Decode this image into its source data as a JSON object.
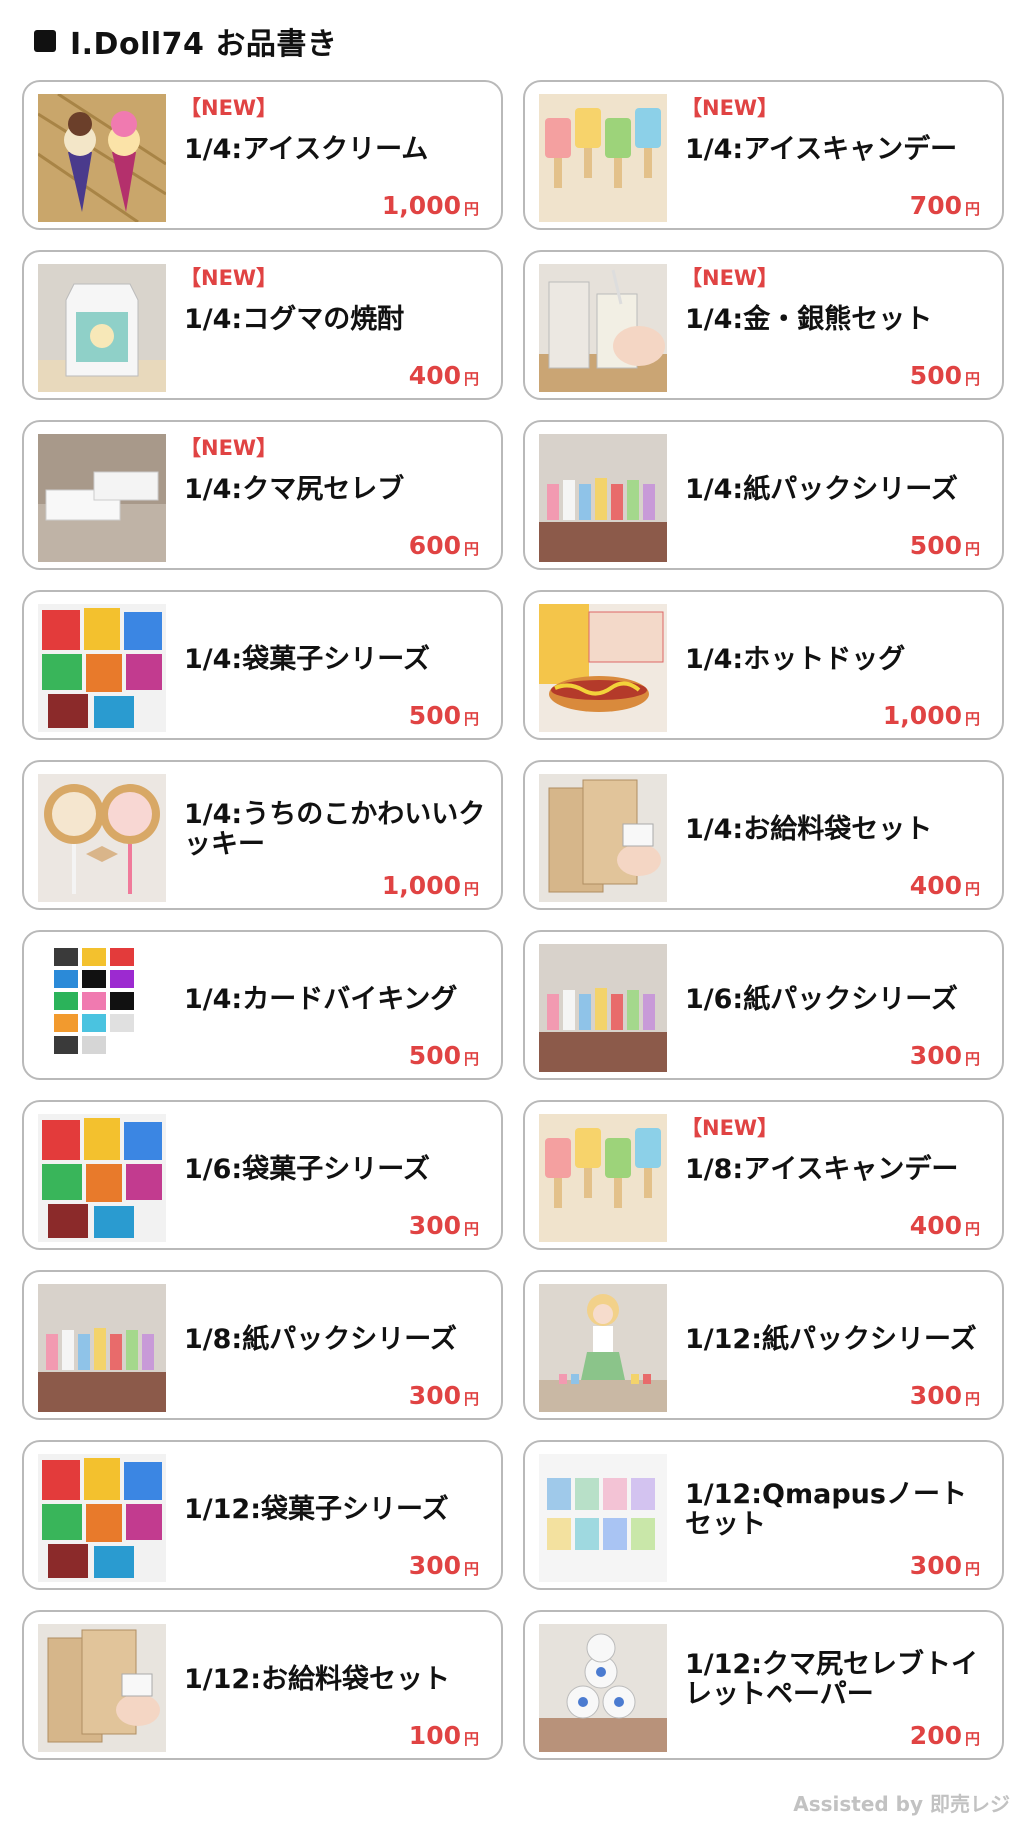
{
  "header": {
    "title": "I.Doll74 お品書き"
  },
  "currency": "円",
  "new_badge": "【NEW】",
  "items": [
    {
      "name": "1/4:アイスクリーム",
      "price": "1,000",
      "is_new": true,
      "thumb": "ice-cream-cones"
    },
    {
      "name": "1/4:アイスキャンデー",
      "price": "700",
      "is_new": true,
      "thumb": "ice-candy-bars"
    },
    {
      "name": "1/4:コグマの焼酎",
      "price": "400",
      "is_new": true,
      "thumb": "shochu-carton"
    },
    {
      "name": "1/4:金・銀熊セット",
      "price": "500",
      "is_new": true,
      "thumb": "gold-silver-bear-set"
    },
    {
      "name": "1/4:クマ尻セレブ",
      "price": "600",
      "is_new": true,
      "thumb": "tissue-boxes"
    },
    {
      "name": "1/4:紙パックシリーズ",
      "price": "500",
      "is_new": false,
      "thumb": "paper-pack-drinks"
    },
    {
      "name": "1/4:袋菓子シリーズ",
      "price": "500",
      "is_new": false,
      "thumb": "bagged-snacks"
    },
    {
      "name": "1/4:ホットドッグ",
      "price": "1,000",
      "is_new": false,
      "thumb": "hotdog"
    },
    {
      "name": "1/4:うちのこかわいいクッキー",
      "price": "1,000",
      "is_new": false,
      "thumb": "cookie-lollipops"
    },
    {
      "name": "1/4:お給料袋セット",
      "price": "400",
      "is_new": false,
      "thumb": "pay-envelopes"
    },
    {
      "name": "1/4:カードバイキング",
      "price": "500",
      "is_new": false,
      "thumb": "cards"
    },
    {
      "name": "1/6:紙パックシリーズ",
      "price": "300",
      "is_new": false,
      "thumb": "paper-pack-drinks"
    },
    {
      "name": "1/6:袋菓子シリーズ",
      "price": "300",
      "is_new": false,
      "thumb": "bagged-snacks"
    },
    {
      "name": "1/8:アイスキャンデー",
      "price": "400",
      "is_new": true,
      "thumb": "ice-candy-bars"
    },
    {
      "name": "1/8:紙パックシリーズ",
      "price": "300",
      "is_new": false,
      "thumb": "paper-pack-drinks"
    },
    {
      "name": "1/12:紙パックシリーズ",
      "price": "300",
      "is_new": false,
      "thumb": "doll-with-packs"
    },
    {
      "name": "1/12:袋菓子シリーズ",
      "price": "300",
      "is_new": false,
      "thumb": "bagged-snacks"
    },
    {
      "name": "1/12:Qmapusノートセット",
      "price": "300",
      "is_new": false,
      "thumb": "notebooks"
    },
    {
      "name": "1/12:お給料袋セット",
      "price": "100",
      "is_new": false,
      "thumb": "pay-envelopes"
    },
    {
      "name": "1/12:クマ尻セレブトイレットペーパー",
      "price": "200",
      "is_new": false,
      "thumb": "toilet-paper"
    }
  ],
  "footer": {
    "text": "Assisted by 即売レジ"
  }
}
